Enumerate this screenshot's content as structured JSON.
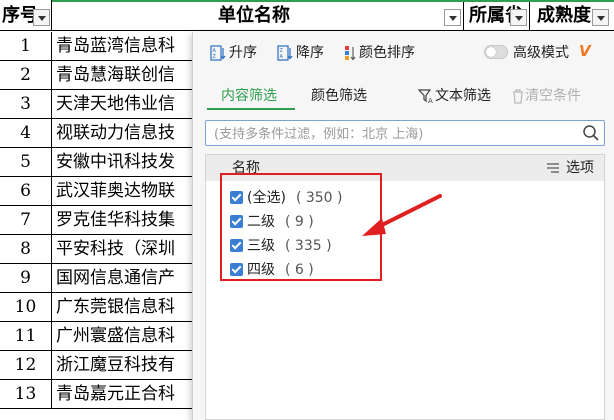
{
  "sheet": {
    "headers": {
      "seq": "序号",
      "unit_name": "单位名称",
      "region": "所属省",
      "maturity": "成熟度"
    },
    "rows": [
      {
        "num": "1",
        "name": "青岛蓝湾信息科"
      },
      {
        "num": "2",
        "name": "青岛慧海联创信"
      },
      {
        "num": "3",
        "name": "天津天地伟业信"
      },
      {
        "num": "4",
        "name": "视联动力信息技"
      },
      {
        "num": "5",
        "name": "安徽中讯科技发"
      },
      {
        "num": "6",
        "name": "武汉菲奥达物联"
      },
      {
        "num": "7",
        "name": "罗克佳华科技集"
      },
      {
        "num": "8",
        "name": "平安科技（深圳"
      },
      {
        "num": "9",
        "name": "国网信息通信产"
      },
      {
        "num": "10",
        "name": "广东莞银信息科"
      },
      {
        "num": "11",
        "name": "广州寰盛信息科"
      },
      {
        "num": "12",
        "name": "浙江魔豆科技有"
      },
      {
        "num": "13",
        "name": "青岛嘉元正合科"
      }
    ]
  },
  "filter_panel": {
    "sort_asc": "升序",
    "sort_desc": "降序",
    "color_sort": "颜色排序",
    "advanced_mode": "高级模式",
    "vip_badge": "V",
    "tab_content": "内容筛选",
    "tab_color": "颜色筛选",
    "text_filter": "文本筛选",
    "clear": "清空条件",
    "search_placeholder": "(支持多条件过滤，例如：北京 上海)",
    "list_header": "名称",
    "options_label": "选项",
    "items": [
      {
        "label": "(全选)",
        "count": "( 350 )",
        "checked": true
      },
      {
        "label": "二级",
        "count": "( 9 )",
        "checked": true
      },
      {
        "label": "三级",
        "count": "( 335 )",
        "checked": true
      },
      {
        "label": "四级",
        "count": "( 6 )",
        "checked": true
      }
    ]
  },
  "colors": {
    "accent_green": "#2e9e4f",
    "checkbox_blue": "#3b7fd4",
    "highlight_red": "#e02020",
    "vip_orange": "#f0781e"
  }
}
